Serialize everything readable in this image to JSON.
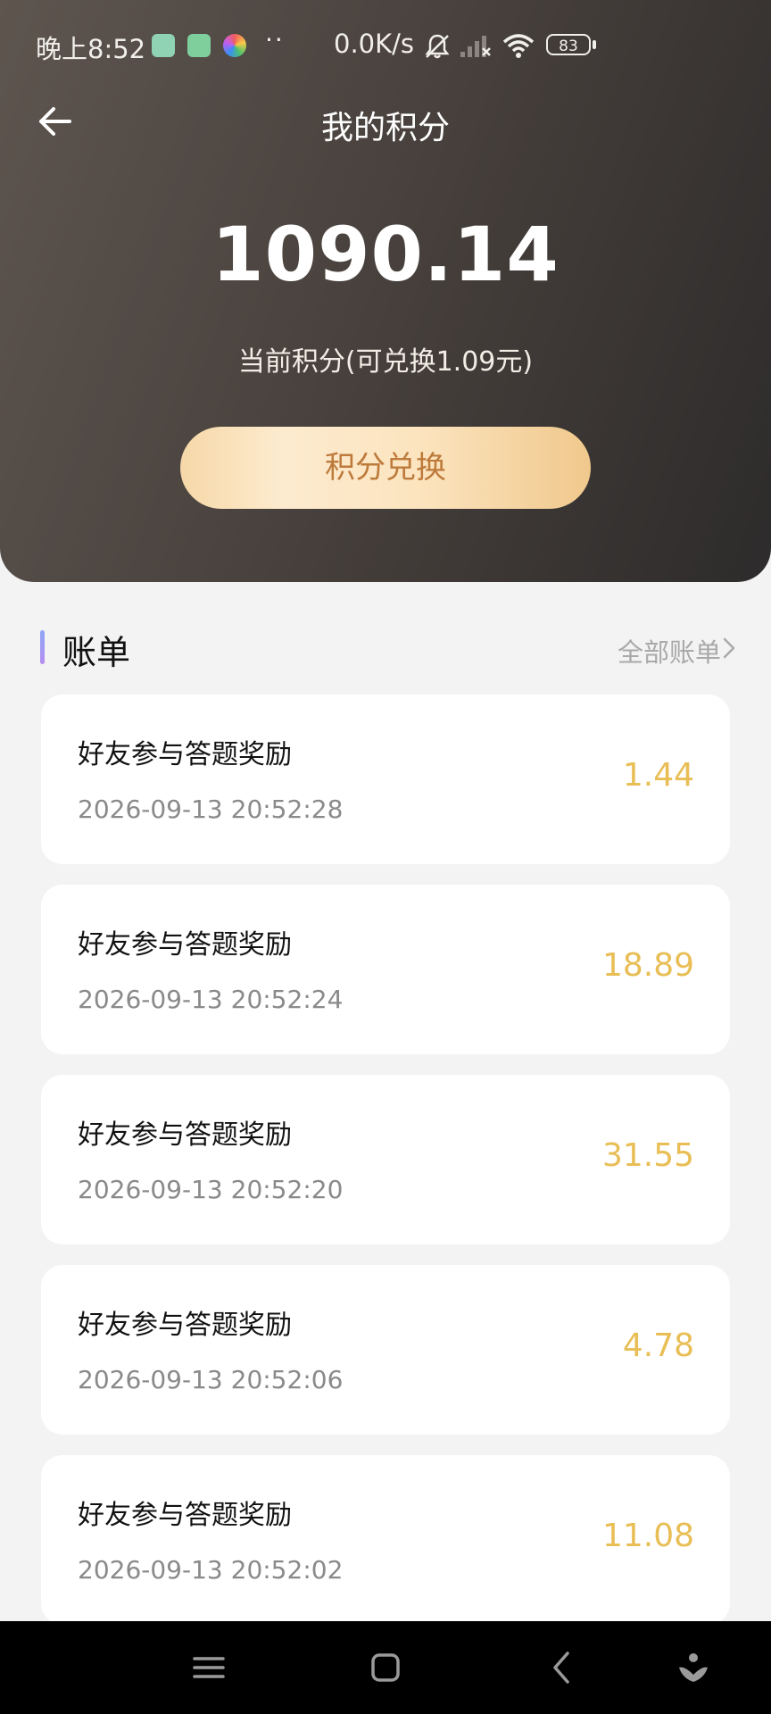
{
  "status_bar": {
    "time": "晚上8:52",
    "dots": "··",
    "net_speed": "0.0K/s",
    "battery": "83",
    "icons": [
      "app-icon-green",
      "app-icon-game",
      "app-icon-color",
      "mute-bell-icon",
      "signal-icon",
      "wifi-icon",
      "battery-icon"
    ]
  },
  "header": {
    "title": "我的积分",
    "back_icon": "back-arrow-icon"
  },
  "summary": {
    "points": "1090.14",
    "subtitle": "当前积分(可兑换1.09元)",
    "exchange_label": "积分兑换"
  },
  "bills": {
    "title": "账单",
    "all_label": "全部账单",
    "items": [
      {
        "title": "好友参与答题奖励",
        "time": "2026-09-13 20:52:28",
        "amount": "1.44"
      },
      {
        "title": "好友参与答题奖励",
        "time": "2026-09-13 20:52:24",
        "amount": "18.89"
      },
      {
        "title": "好友参与答题奖励",
        "time": "2026-09-13 20:52:20",
        "amount": "31.55"
      },
      {
        "title": "好友参与答题奖励",
        "time": "2026-09-13 20:52:06",
        "amount": "4.78"
      },
      {
        "title": "好友参与答题奖励",
        "time": "2026-09-13 20:52:02",
        "amount": "11.08"
      }
    ]
  },
  "colors": {
    "amount": "#e8be55",
    "exchange_text": "#bd7a3b",
    "hero_dark": "#2d2b2b",
    "hero_light": "#5e554f"
  },
  "nav": {
    "icons": [
      "menu-icon",
      "home-icon",
      "back-icon",
      "assistant-icon"
    ]
  }
}
